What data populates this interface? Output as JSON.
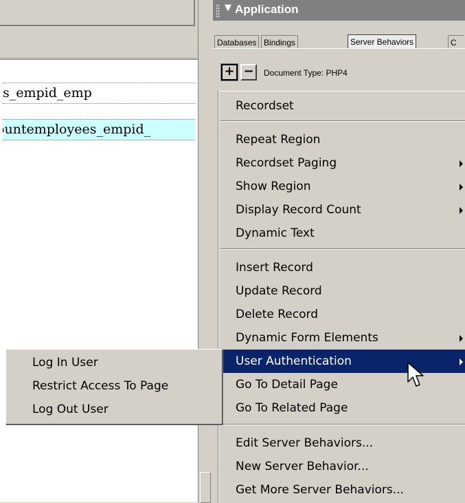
{
  "document": {
    "code_lines": [
      "s_empid_emp",
      "ountemployees_empid_"
    ]
  },
  "panel": {
    "title": "Application",
    "tabs": [
      {
        "label": "Databases"
      },
      {
        "label": "Bindings"
      },
      {
        "label": "Server Behaviors"
      },
      {
        "label": "C"
      }
    ],
    "toolbar": {
      "add_label": "+",
      "remove_label": "−",
      "document_type": "Document Type: PHP4"
    }
  },
  "menu": {
    "items": [
      {
        "label": "Recordset"
      },
      {
        "label": "Repeat Region"
      },
      {
        "label": "Recordset Paging",
        "submenu": true
      },
      {
        "label": "Show Region",
        "submenu": true
      },
      {
        "label": "Display Record Count",
        "submenu": true
      },
      {
        "label": "Dynamic Text"
      },
      {
        "label": "Insert Record"
      },
      {
        "label": "Update Record"
      },
      {
        "label": "Delete Record"
      },
      {
        "label": "Dynamic Form Elements",
        "submenu": true
      },
      {
        "label": "User Authentication",
        "submenu": true,
        "selected": true
      },
      {
        "label": "Go To Detail Page"
      },
      {
        "label": "Go To Related Page"
      },
      {
        "label": "Edit Server Behaviors..."
      },
      {
        "label": "New Server Behavior..."
      },
      {
        "label": "Get More Server Behaviors..."
      }
    ]
  },
  "submenu": {
    "items": [
      {
        "label": "Log In User"
      },
      {
        "label": "Restrict Access To Page"
      },
      {
        "label": "Log Out User"
      }
    ]
  },
  "colors": {
    "selection": "#0a246a",
    "chrome": "#d4d0c8",
    "highlight_line": "#ccffff"
  }
}
